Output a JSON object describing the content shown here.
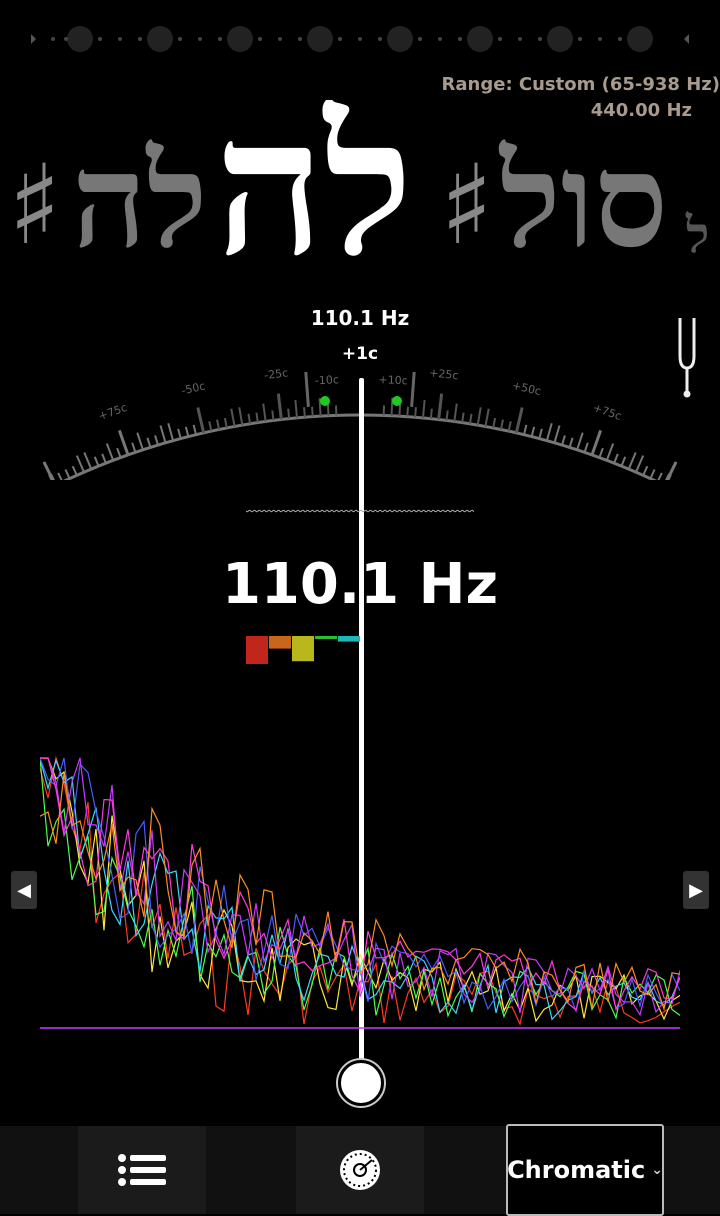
{
  "header": {
    "range_text": "Range: Custom (65-938 Hz)",
    "reference_freq": "440.00 Hz",
    "range_color": "#a89a8c"
  },
  "notes": {
    "current": "לה",
    "items": [
      {
        "label": "♯",
        "color": "#888888"
      },
      {
        "label": "לה",
        "color": "#777777"
      },
      {
        "label": "לה",
        "color": "#ffffff"
      },
      {
        "label": "♯",
        "color": "#888888"
      },
      {
        "label": "סול",
        "color": "#777777"
      },
      {
        "label": "ל",
        "color": "#555555"
      }
    ]
  },
  "meter": {
    "frequency": "110.1 Hz",
    "cents": "+1c",
    "scale_labels": [
      "+75c",
      "-50c",
      "-25c",
      "-10c",
      "+10c",
      "+25c",
      "+50c",
      "+75c"
    ],
    "in_tune_color": "#1ecb1e"
  },
  "readout": {
    "frequency": "110.1 Hz"
  },
  "harmonic_bars": [
    {
      "color": "#c0261c",
      "level": 1.0
    },
    {
      "color": "#c8661c",
      "level": 0.45
    },
    {
      "color": "#b8b81c",
      "level": 0.9
    },
    {
      "color": "#2ebd2e",
      "level": 0.1
    },
    {
      "color": "#1cb8b8",
      "level": 0.2
    }
  ],
  "spectrum": {
    "colors": [
      "#ff3b1f",
      "#ffe63b",
      "#4cff4c",
      "#3bd8ff",
      "#4b5bff",
      "#c83bff",
      "#ff3bd8",
      "#ff8c1f"
    ]
  },
  "nav": {
    "left_arrow": "◀",
    "right_arrow": "▶"
  },
  "toolbar": {
    "menu_icon": "list-icon",
    "dial_icon": "dial-icon",
    "mode_value": "Chromatic",
    "mode_chevron": "⌄"
  }
}
